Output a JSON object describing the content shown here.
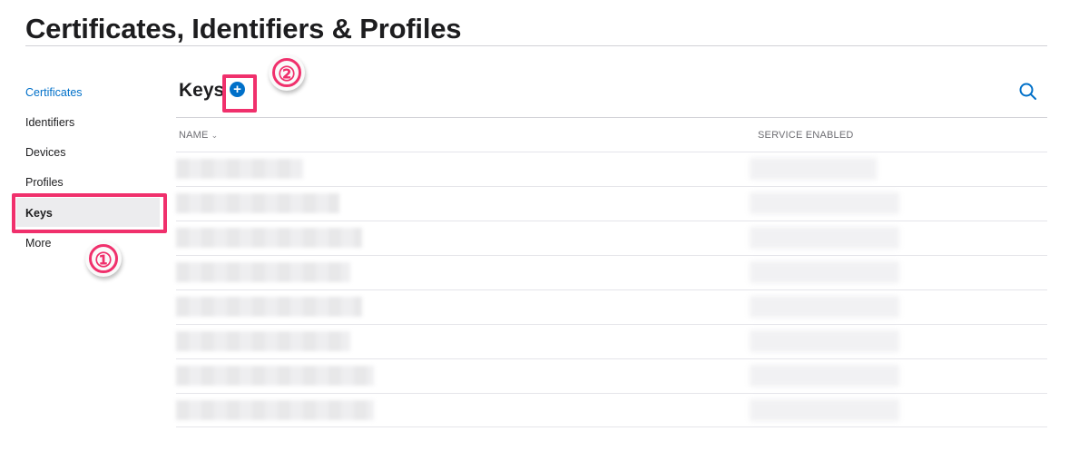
{
  "page": {
    "title": "Certificates, Identifiers & Profiles"
  },
  "sidebar": {
    "items": [
      {
        "label": "Certificates",
        "active": true
      },
      {
        "label": "Identifiers"
      },
      {
        "label": "Devices"
      },
      {
        "label": "Profiles"
      },
      {
        "label": "Keys",
        "selected": true
      },
      {
        "label": "More"
      }
    ]
  },
  "main": {
    "section_title": "Keys",
    "add_button_glyph": "+",
    "search_icon": "magnifying-glass",
    "columns": [
      {
        "label": "NAME",
        "sortable": true,
        "sort": "descending"
      },
      {
        "label": "SERVICE ENABLED"
      }
    ],
    "rows_note_count": 8
  },
  "annotations": {
    "step1": "①",
    "step2": "②",
    "highlight_color": "#f0306c"
  },
  "colors": {
    "accent": "#0070c9",
    "text": "#1d1d1f",
    "muted": "#6e6e73",
    "divider": "#d2d2d7"
  }
}
